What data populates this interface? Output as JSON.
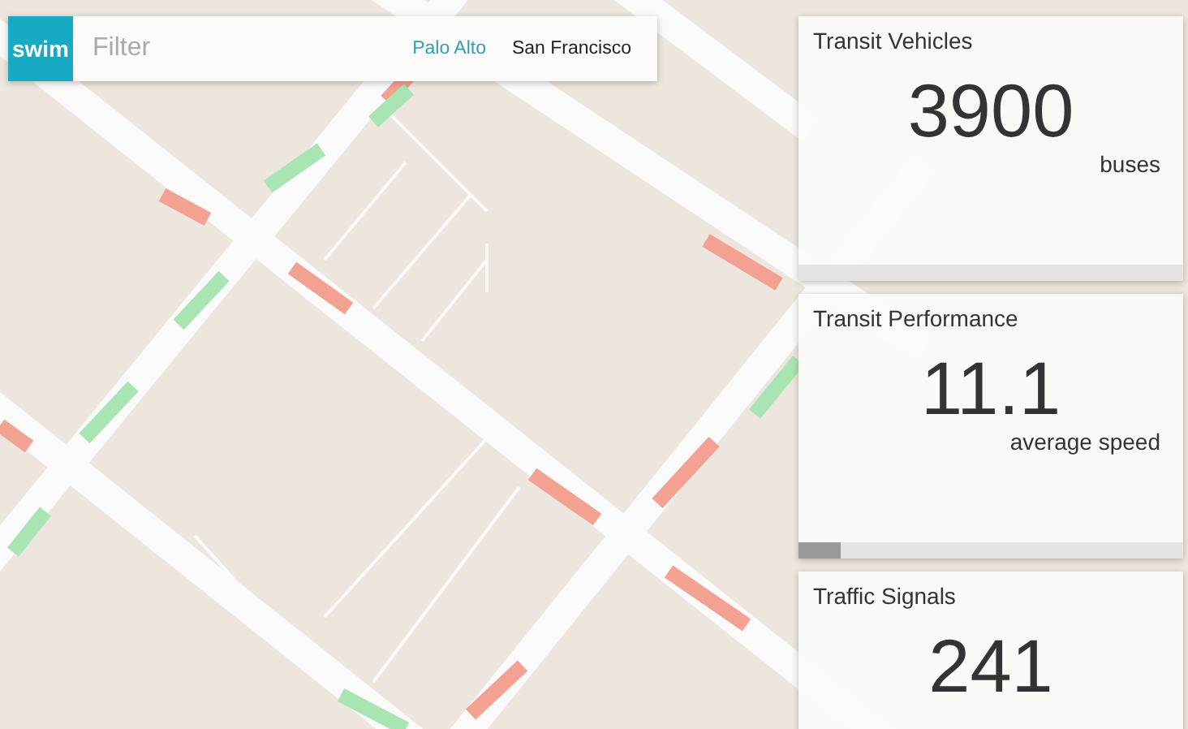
{
  "search": {
    "logo": "swim",
    "placeholder": "Filter",
    "locations": [
      {
        "label": "Palo Alto",
        "selected": true
      },
      {
        "label": "San Francisco",
        "selected": false
      }
    ]
  },
  "cards": [
    {
      "title": "Transit Vehicles",
      "value": "3900",
      "unit": "buses",
      "level": 0
    },
    {
      "title": "Transit Performance",
      "value": "11.1",
      "unit": "average speed",
      "level": 0.11
    },
    {
      "title": "Traffic Signals",
      "value": "241"
    }
  ]
}
